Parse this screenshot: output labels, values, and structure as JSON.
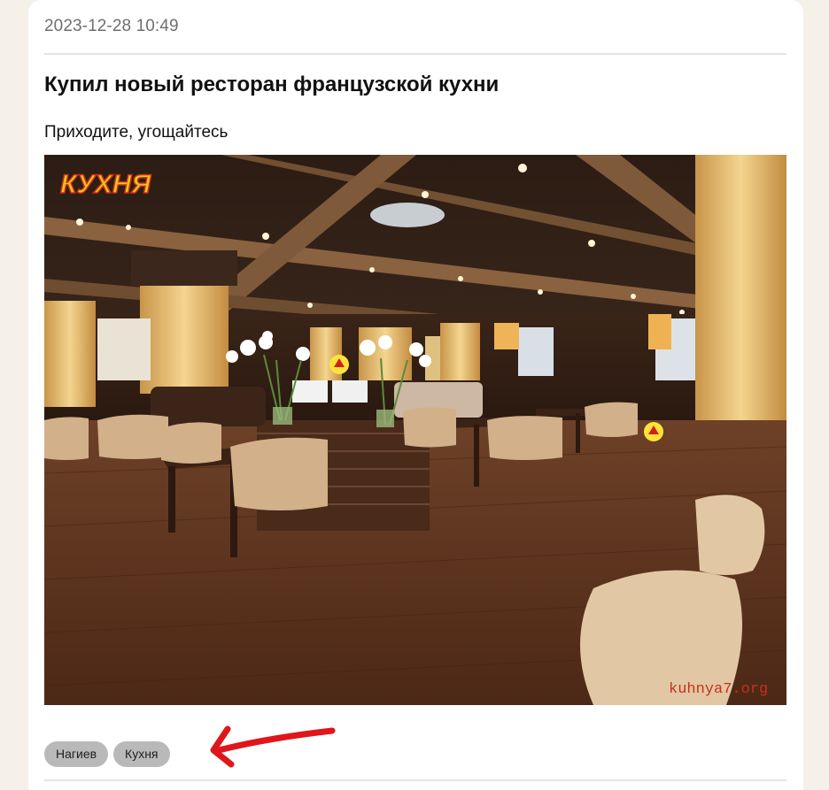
{
  "post": {
    "timestamp": "2023-12-28 10:49",
    "title": "Купил новый ресторан французской кухни",
    "body": "Приходите, угощайтесь",
    "image": {
      "logo_text": "КУХНЯ",
      "watermark": "kuhnya7.org"
    },
    "tags": [
      "Нагиев",
      "Кухня"
    ]
  },
  "annotation": {
    "arrow_color": "#e0161b"
  }
}
